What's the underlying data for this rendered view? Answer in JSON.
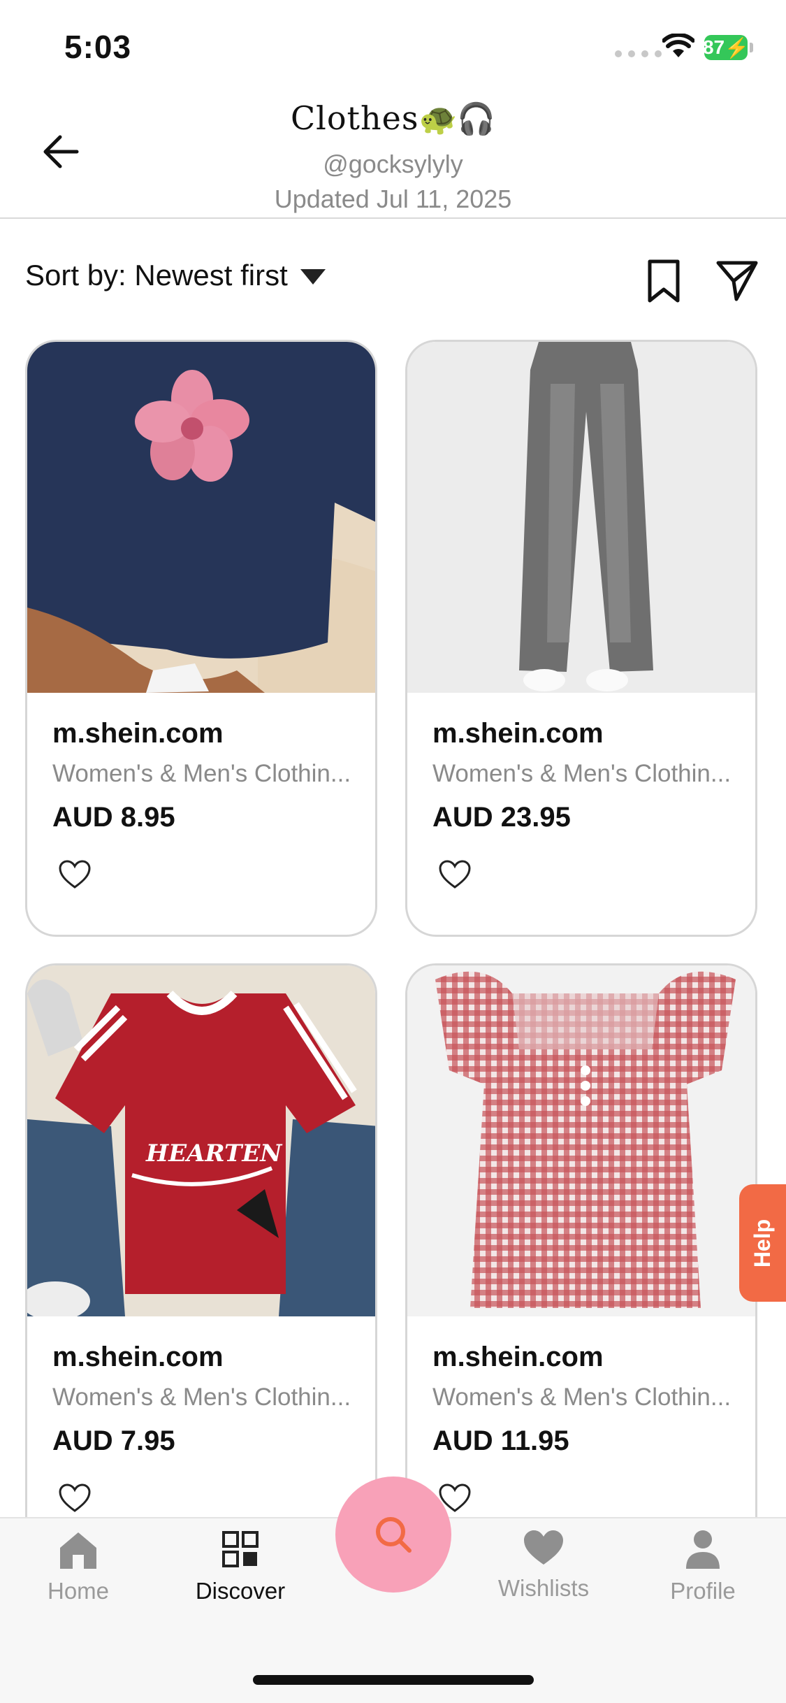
{
  "status_bar": {
    "time": "5:03",
    "battery": "87"
  },
  "header": {
    "title": "Clothes",
    "title_emoji": "🐢🎧",
    "handle": "@gocksylyly",
    "updated": "Updated Jul 11, 2025"
  },
  "sort": {
    "label": "Sort by: Newest first"
  },
  "products": [
    {
      "domain": "m.shein.com",
      "description": "Women's & Men's Clothin...",
      "price": "AUD 8.95",
      "image": "navy-tshirt-pink-flower"
    },
    {
      "domain": "m.shein.com",
      "description": "Women's & Men's Clothin...",
      "price": "AUD 23.95",
      "image": "grey-wide-leg-jeans"
    },
    {
      "domain": "m.shein.com",
      "description": "Women's & Men's Clothin...",
      "price": "AUD 7.95",
      "image": "red-ringer-tee-hearten"
    },
    {
      "domain": "m.shein.com",
      "description": "Women's & Men's Clothin...",
      "price": "AUD 11.95",
      "image": "red-gingham-blouse"
    }
  ],
  "help": {
    "label": "Help"
  },
  "nav": {
    "items": [
      {
        "label": "Home",
        "icon": "home-icon"
      },
      {
        "label": "Discover",
        "icon": "discover-icon"
      },
      {
        "label": "Wishlists",
        "icon": "heart-icon"
      },
      {
        "label": "Profile",
        "icon": "profile-icon"
      }
    ],
    "active": "Discover"
  },
  "colors": {
    "accent_fab": "#f8a1b8",
    "fab_icon": "#f26a45",
    "help": "#f26a45",
    "battery": "#34c759"
  }
}
